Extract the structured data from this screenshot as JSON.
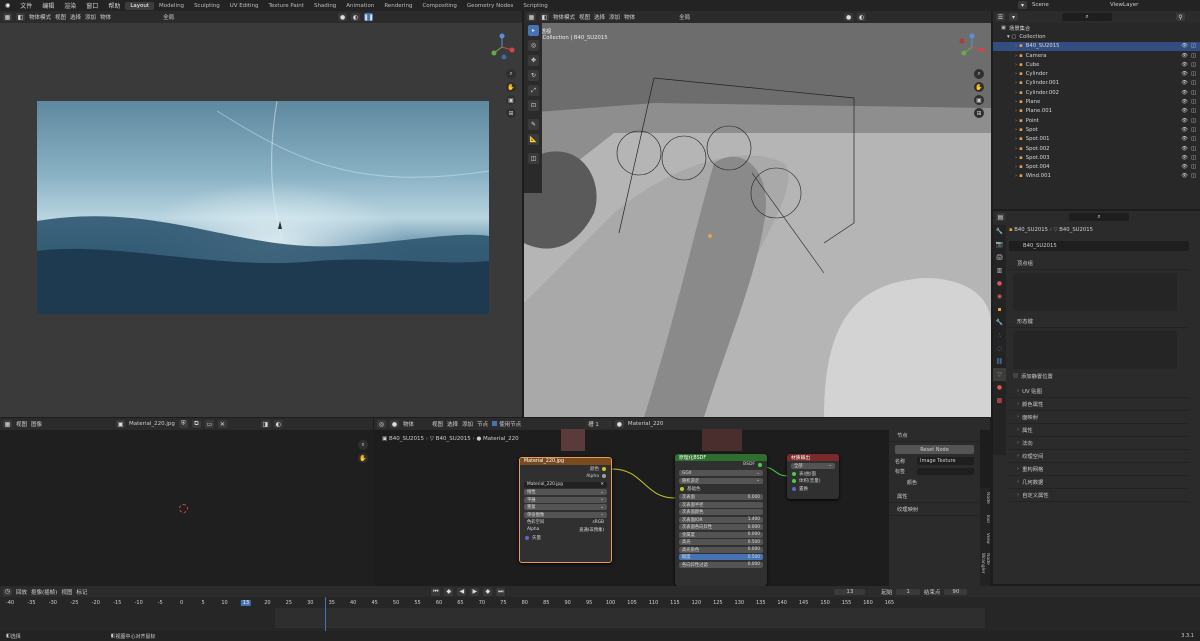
{
  "topbar": {
    "menus": [
      "文件",
      "编辑",
      "渲染",
      "窗口",
      "帮助"
    ],
    "workspaces": [
      "Layout",
      "Modeling",
      "Sculpting",
      "UV Editing",
      "Texture Paint",
      "Shading",
      "Animation",
      "Rendering",
      "Compositing",
      "Geometry Nodes",
      "Scripting"
    ],
    "active_workspace": "Layout",
    "scene_label": "Scene",
    "view_layer_label": "ViewLayer"
  },
  "image_viewport": {
    "mode": "物体模式",
    "menus": [
      "视图",
      "选择",
      "添加",
      "物体"
    ],
    "orient": "全局"
  },
  "viewport3d": {
    "mode": "物体模式",
    "menus": [
      "视图",
      "选择",
      "添加",
      "物体"
    ],
    "orient": "全局",
    "overlay_title": "用户透视",
    "overlay_sub": "(13) Collection | B40_SU2015"
  },
  "outliner": {
    "header": "场景集合",
    "collection": "Collection",
    "items": [
      {
        "name": "B40_SU2015",
        "selected": true,
        "color": "#e69f4c"
      },
      {
        "name": "Camera",
        "selected": false,
        "color": "#e69f4c"
      },
      {
        "name": "Cube",
        "selected": false,
        "color": "#e69f4c"
      },
      {
        "name": "Cylinder",
        "selected": false,
        "color": "#e69f4c"
      },
      {
        "name": "Cylinder.001",
        "selected": false,
        "color": "#e69f4c"
      },
      {
        "name": "Cylinder.002",
        "selected": false,
        "color": "#e69f4c"
      },
      {
        "name": "Plane",
        "selected": false,
        "color": "#e69f4c"
      },
      {
        "name": "Plane.001",
        "selected": false,
        "color": "#e69f4c"
      },
      {
        "name": "Point",
        "selected": false,
        "color": "#e69f4c"
      },
      {
        "name": "Spot",
        "selected": false,
        "color": "#e69f4c"
      },
      {
        "name": "Spot.001",
        "selected": false,
        "color": "#e69f4c"
      },
      {
        "name": "Spot.002",
        "selected": false,
        "color": "#e69f4c"
      },
      {
        "name": "Spot.003",
        "selected": false,
        "color": "#e69f4c"
      },
      {
        "name": "Spot.004",
        "selected": false,
        "color": "#e69f4c"
      },
      {
        "name": "Wind.001",
        "selected": false,
        "color": "#e69f4c"
      }
    ]
  },
  "properties": {
    "breadcrumb_obj": "B40_SU2015",
    "breadcrumb_data": "B40_SU2015",
    "mesh_name": "B40_SU2015",
    "panel_vertex_groups": "顶点组",
    "panel_shape_keys": "形态键",
    "add_rest_position": "添加静置位置",
    "sections": [
      "UV 贴图",
      "颜色属性",
      "面映射",
      "属性",
      "法向",
      "纹理空间",
      "重构网格",
      "几何数据",
      "自定义属性"
    ]
  },
  "image_editor": {
    "menus": [
      "视图",
      "图像"
    ],
    "image_name": "Material_220.jpg"
  },
  "node_editor": {
    "header_menus": [
      "物体",
      "视图",
      "选择",
      "添加",
      "节点"
    ],
    "use_nodes": "使用节点",
    "slot": "槽 1",
    "material": "Material_220",
    "breadcrumb": [
      "B40_SU2015",
      "B40_SU2015",
      "Material_220"
    ],
    "tex_node": {
      "title": "Material_220.jpg",
      "out_color": "颜色",
      "out_alpha": "Alpha",
      "image": "Material_220.jpg",
      "fields": [
        "线性",
        "平展",
        "重复",
        "单张图像"
      ],
      "colorspace_label": "色彩空间",
      "colorspace": "sRGB",
      "alpha_label": "Alpha",
      "alpha": "直通(非预乘)",
      "vector": "矢量"
    },
    "bsdf_node": {
      "title": "原理化BSDF",
      "out": "BSDF",
      "fields": [
        "GGX",
        "随机游走"
      ],
      "in_color": "基础色",
      "rows": [
        {
          "label": "次表面",
          "value": "0.000"
        },
        {
          "label": "次表面半径",
          "value": ""
        },
        {
          "label": "次表面颜色",
          "value": ""
        },
        {
          "label": "次表面IOR",
          "value": "1.400"
        },
        {
          "label": "次表面各向异性",
          "value": "0.000"
        },
        {
          "label": "金属度",
          "value": "0.000"
        },
        {
          "label": "高光",
          "value": "0.500"
        },
        {
          "label": "高光染色",
          "value": "0.000"
        },
        {
          "label": "糙度",
          "value": "0.500"
        },
        {
          "label": "各向异性过滤",
          "value": "0.000"
        }
      ]
    },
    "output_node": {
      "title": "材质输出",
      "target": "全部",
      "inputs": [
        "表(曲)面",
        "体积(音量)",
        "置换"
      ]
    },
    "side_panel": {
      "section": "节点",
      "reset": "Reset Node",
      "name_label": "名称",
      "name": "Image Texture",
      "label_label": "标签",
      "color": "颜色",
      "props": "属性",
      "tex_map": "纹理映射"
    },
    "side_tabs": [
      "Node",
      "Tool",
      "View",
      "Node Wrangler"
    ]
  },
  "timeline": {
    "menus": [
      "回放",
      "抠像(插帧)",
      "视图",
      "标记"
    ],
    "current": "13",
    "start_label": "起始",
    "start": "1",
    "end_label": "结束点",
    "end": "90",
    "ticks": [
      "-40",
      "-35",
      "-30",
      "-25",
      "-20",
      "-15",
      "-10",
      "-5",
      "0",
      "5",
      "10",
      "13",
      "20",
      "25",
      "30",
      "35",
      "40",
      "45",
      "50",
      "55",
      "60",
      "65",
      "70",
      "75",
      "80",
      "85",
      "90",
      "95",
      "100",
      "105",
      "110",
      "115",
      "120",
      "125",
      "130",
      "135",
      "140",
      "145",
      "150",
      "155",
      "160",
      "165"
    ]
  },
  "statusbar": {
    "left": "选择",
    "middle": "视图中心对齐鼠标",
    "version": "3.3.1"
  }
}
